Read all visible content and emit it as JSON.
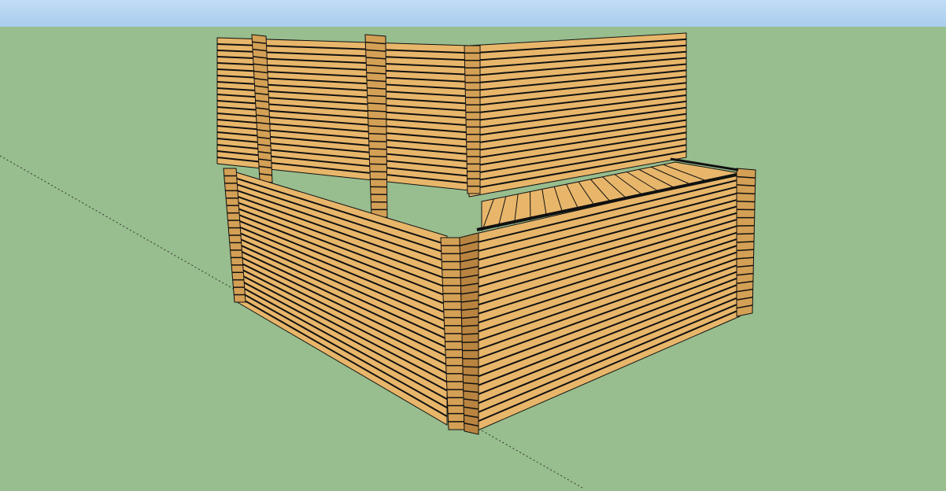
{
  "app": {},
  "scene": {
    "sky_color": "#c2dcf5",
    "sky_color_bottom": "#a9cdef",
    "ground_color": "#98bd8e",
    "wood_color": "#e8b66a",
    "wood_shade": "#d4a055",
    "wood_dark": "#b98440",
    "edge_color": "#111111",
    "axis_color": "#333333",
    "lower_plank_count": 22,
    "upper_plank_count": 20,
    "deck_board_count": 16
  }
}
